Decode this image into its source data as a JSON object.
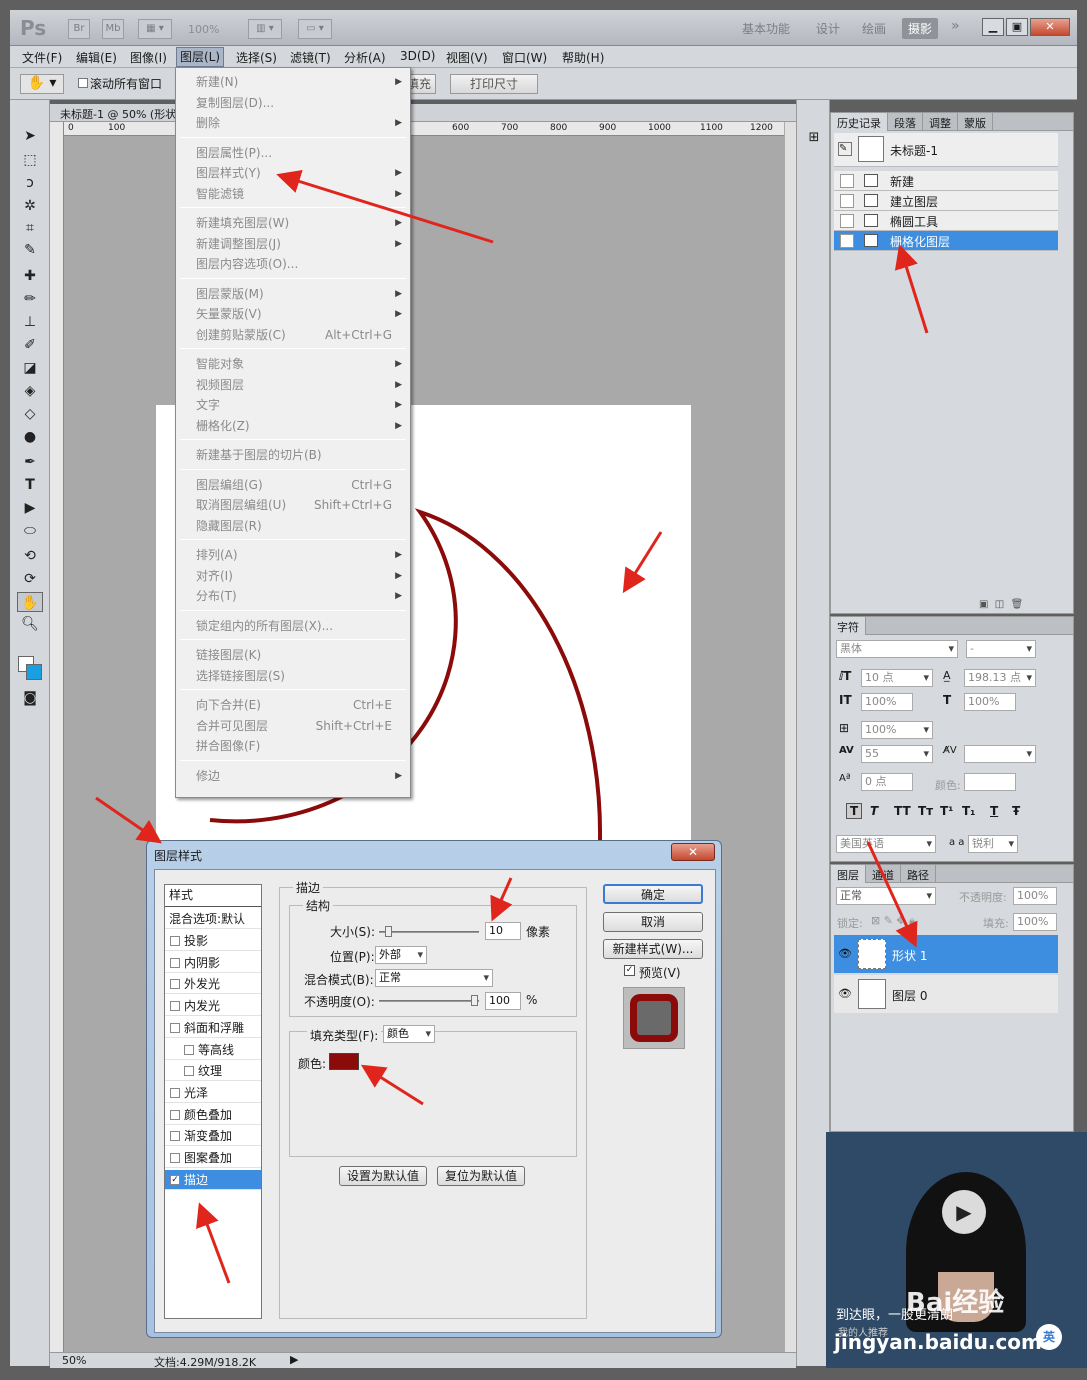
{
  "app": {
    "logo": "Ps",
    "bridge": "Br",
    "minibridge": "Mb",
    "zoom": "100%"
  },
  "workspaces": {
    "basic": "基本功能",
    "design": "设计",
    "paint": "绘画",
    "photo": "摄影",
    "more": "»"
  },
  "menubar": [
    "文件(F)",
    "编辑(E)",
    "图像(I)",
    "图层(L)",
    "选择(S)",
    "滤镜(T)",
    "分析(A)",
    "3D(D)",
    "视图(V)",
    "窗口(W)",
    "帮助(H)"
  ],
  "options": {
    "scroll_all": "滚动所有窗口",
    "fill_screen": "填充屏幕",
    "print_size": "打印尺寸"
  },
  "doc": {
    "tab": "未标题-1 @ 50% (形状",
    "ruler": [
      "0",
      "100",
      "600",
      "700",
      "800",
      "900",
      "1000",
      "1100",
      "1200"
    ],
    "zoom": "50%",
    "info": "文档:4.29M/918.2K"
  },
  "layer_menu": {
    "items": [
      {
        "label": "新建(N)",
        "shortcut": "",
        "arrow": true
      },
      {
        "label": "复制图层(D)...",
        "shortcut": "",
        "arrow": false
      },
      {
        "label": "删除",
        "shortcut": "",
        "arrow": true
      },
      {
        "label": "图层属性(P)...",
        "shortcut": "",
        "arrow": false
      },
      {
        "label": "图层样式(Y)",
        "shortcut": "",
        "arrow": true
      },
      {
        "label": "智能滤镜",
        "shortcut": "",
        "arrow": true
      },
      {
        "label": "新建填充图层(W)",
        "shortcut": "",
        "arrow": true
      },
      {
        "label": "新建调整图层(J)",
        "shortcut": "",
        "arrow": true
      },
      {
        "label": "图层内容选项(O)...",
        "shortcut": "",
        "arrow": false
      },
      {
        "label": "图层蒙版(M)",
        "shortcut": "",
        "arrow": true
      },
      {
        "label": "矢量蒙版(V)",
        "shortcut": "",
        "arrow": true
      },
      {
        "label": "创建剪贴蒙版(C)",
        "shortcut": "Alt+Ctrl+G",
        "arrow": false
      },
      {
        "label": "智能对象",
        "shortcut": "",
        "arrow": true
      },
      {
        "label": "视频图层",
        "shortcut": "",
        "arrow": true
      },
      {
        "label": "文字",
        "shortcut": "",
        "arrow": true
      },
      {
        "label": "栅格化(Z)",
        "shortcut": "",
        "arrow": true
      },
      {
        "label": "新建基于图层的切片(B)",
        "shortcut": "",
        "arrow": false
      },
      {
        "label": "图层编组(G)",
        "shortcut": "Ctrl+G",
        "arrow": false
      },
      {
        "label": "取消图层编组(U)",
        "shortcut": "Shift+Ctrl+G",
        "arrow": false
      },
      {
        "label": "隐藏图层(R)",
        "shortcut": "",
        "arrow": false
      },
      {
        "label": "排列(A)",
        "shortcut": "",
        "arrow": true
      },
      {
        "label": "对齐(I)",
        "shortcut": "",
        "arrow": true
      },
      {
        "label": "分布(T)",
        "shortcut": "",
        "arrow": true
      },
      {
        "label": "锁定组内的所有图层(X)...",
        "shortcut": "",
        "arrow": false
      },
      {
        "label": "链接图层(K)",
        "shortcut": "",
        "arrow": false
      },
      {
        "label": "选择链接图层(S)",
        "shortcut": "",
        "arrow": false
      },
      {
        "label": "向下合并(E)",
        "shortcut": "Ctrl+E",
        "arrow": false
      },
      {
        "label": "合并可见图层",
        "shortcut": "Shift+Ctrl+E",
        "arrow": false
      },
      {
        "label": "拼合图像(F)",
        "shortcut": "",
        "arrow": false
      },
      {
        "label": "修边",
        "shortcut": "",
        "arrow": true
      }
    ]
  },
  "history": {
    "tabs": [
      "历史记录",
      "段落",
      "调整",
      "蒙版"
    ],
    "snapshot": "未标题-1",
    "items": [
      "新建",
      "建立图层",
      "椭圆工具",
      "栅格化图层"
    ]
  },
  "character": {
    "tab": "字符",
    "font": "黑体",
    "style": "-",
    "size": "10 点",
    "leading": "198.13 点",
    "vscale": "100%",
    "hscale": "100%",
    "tracking_scale": "100%",
    "kerning": "55",
    "baseline": "0 点",
    "color_label": "颜色:",
    "lang": "美国英语",
    "aa_label": "a a",
    "aa": "锐利",
    "buttons": [
      "T",
      "T",
      "TT",
      "Tт",
      "T¹",
      "T₁",
      "T",
      "Ŧ"
    ]
  },
  "layers": {
    "tabs": [
      "图层",
      "通道",
      "路径"
    ],
    "blend": "正常",
    "opacity_label": "不透明度:",
    "opacity": "100%",
    "lock_label": "锁定:",
    "fill_label": "填充:",
    "fill": "100%",
    "items": [
      "形状 1",
      "图层 0"
    ]
  },
  "dialog": {
    "title": "图层样式",
    "close": "✕",
    "styles_header": "样式",
    "blend_options": "混合选项:默认",
    "effects": [
      {
        "label": "投影",
        "checked": false,
        "sub": false
      },
      {
        "label": "内阴影",
        "checked": false,
        "sub": false
      },
      {
        "label": "外发光",
        "checked": false,
        "sub": false
      },
      {
        "label": "内发光",
        "checked": false,
        "sub": false
      },
      {
        "label": "斜面和浮雕",
        "checked": false,
        "sub": false
      },
      {
        "label": "等高线",
        "checked": false,
        "sub": true
      },
      {
        "label": "纹理",
        "checked": false,
        "sub": true
      },
      {
        "label": "光泽",
        "checked": false,
        "sub": false
      },
      {
        "label": "颜色叠加",
        "checked": false,
        "sub": false
      },
      {
        "label": "渐变叠加",
        "checked": false,
        "sub": false
      },
      {
        "label": "图案叠加",
        "checked": false,
        "sub": false
      },
      {
        "label": "描边",
        "checked": true,
        "sub": false
      }
    ],
    "stroke_group": "描边",
    "structure_group": "结构",
    "size_label": "大小(S):",
    "size": "10",
    "size_unit": "像素",
    "position_label": "位置(P):",
    "position": "外部",
    "blend_label": "混合模式(B):",
    "blend": "正常",
    "opacity_label": "不透明度(O):",
    "opacity": "100",
    "opacity_unit": "%",
    "fill_type_label": "填充类型(F):",
    "fill_type": "颜色",
    "color_label": "颜色:",
    "stroke_color": "#8b0a0a",
    "ok": "确定",
    "cancel": "取消",
    "new_style": "新建样式(W)...",
    "preview": "预览(V)",
    "set_default": "设置为默认值",
    "reset_default": "复位为默认值"
  },
  "video": {
    "caption": "到达眼，一股更清朗",
    "source": "我的人推荐",
    "watermark": "Bai经验",
    "watermark_url": "jingyan.baidu.com",
    "ime": "英"
  },
  "colors": {
    "accent": "#3d8ee0",
    "arrow": "#e0261c",
    "circle": "#8b0a0a"
  }
}
